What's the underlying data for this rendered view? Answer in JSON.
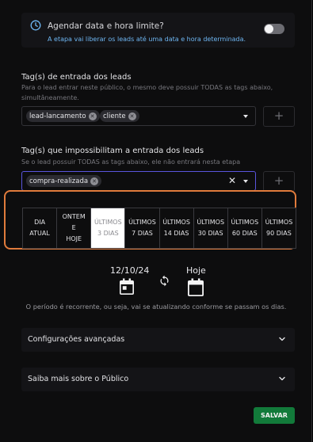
{
  "schedule": {
    "title": "Agendar data e hora limite?",
    "description": "A etapa vai liberar os leads até uma data e hora determinada.",
    "enabled": false
  },
  "entry_tags": {
    "title": "Tag(s) de entrada dos leads",
    "description": "Para o lead entrar neste público, o mesmo deve possuir TODAS as tags abaixo, simultâneamente.",
    "tags": [
      "lead-lancamento",
      "cliente"
    ],
    "add_label": "+"
  },
  "blocking_tags": {
    "title": "Tag(s) que impossibilitam a entrada dos leads",
    "description": "Se o lead possuir TODAS as tags abaixo, ele não entrará nesta etapa",
    "tags": [
      "compra-realizada"
    ],
    "clear_label": "✕",
    "add_label": "+"
  },
  "periods": {
    "items": [
      {
        "label": "DIA\nATUAL",
        "active": false
      },
      {
        "label": "ONTEM\nE\nHOJE",
        "active": false
      },
      {
        "label": "ÚLTIMOS\n3 DIAS",
        "active": true
      },
      {
        "label": "ÚLTIMOS\n7 DIAS",
        "active": false
      },
      {
        "label": "ÚLTIMOS\n14 DIAS",
        "active": false
      },
      {
        "label": "ÚLTIMOS\n30 DIAS",
        "active": false
      },
      {
        "label": "ÚLTIMOS\n60 DIAS",
        "active": false
      },
      {
        "label": "ÚLTIMOS\n90 DIAS",
        "active": false
      }
    ],
    "highlight_color": "#e07b3c"
  },
  "range": {
    "start": "12/10/24",
    "end": "Hoje",
    "recurrence_note": "O período é recorrente, ou seja, vai se atualizando conforme se passam os dias."
  },
  "accordions": {
    "advanced": "Configurações avançadas",
    "about": "Saiba mais sobre o Público"
  },
  "actions": {
    "save": "SALVAR",
    "save_color": "#127a3a"
  }
}
